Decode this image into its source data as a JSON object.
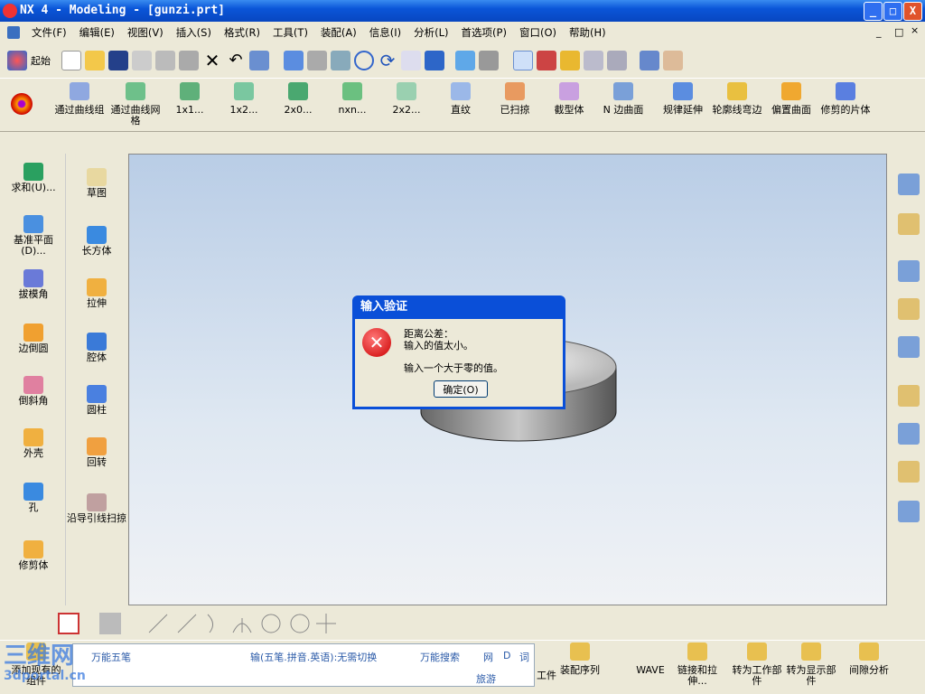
{
  "window": {
    "title": "NX 4 - Modeling - [gunzi.prt]",
    "minimize": "_",
    "maximize": "□",
    "close": "X",
    "doc_min": "_",
    "doc_max": "□",
    "doc_close": "×"
  },
  "menu": [
    "文件(F)",
    "编辑(E)",
    "视图(V)",
    "插入(S)",
    "格式(R)",
    "工具(T)",
    "装配(A)",
    "信息(I)",
    "分析(L)",
    "首选项(P)",
    "窗口(O)",
    "帮助(H)"
  ],
  "toolbar1": {
    "start_label": "起始",
    "icons": [
      "new-file-icon",
      "open-folder-icon",
      "save-icon",
      "cut-icon",
      "copy-icon",
      "paste-icon",
      "delete-icon",
      "undo-icon",
      "info-icon",
      "fit-icon",
      "zoom-window-icon",
      "zoom-area-icon",
      "zoom-icon",
      "rotate-icon",
      "pan-icon",
      "shade-icon",
      "cube-view-icon",
      "render-icon",
      "wcs-icon",
      "sketch-icon",
      "flow-icon",
      "measure-icon",
      "ruler-icon"
    ]
  },
  "toolbar2": {
    "tools": [
      "通过曲线组",
      "通过曲线网格",
      "1x1...",
      "1x2...",
      "2x0...",
      "nxn...",
      "2x2...",
      "直纹",
      "已扫掠",
      "截型体",
      "N 边曲面",
      "规律延伸",
      "轮廓线弯边",
      "偏置曲面",
      "修剪的片体"
    ]
  },
  "left_col1": [
    "求和(U)...",
    "基准平面(D)...",
    "拔模角",
    "边倒圆",
    "倒斜角",
    "外壳",
    "孔",
    "修剪体"
  ],
  "left_col2": [
    "草图",
    "长方体",
    "拉伸",
    "腔体",
    "圆柱",
    "回转",
    "沿导引线扫掠"
  ],
  "right_icons": [
    "assembly-navigator-icon",
    "part-navigator-icon",
    "web-browser-icon",
    "training-icon",
    "help-icon",
    "history-icon",
    "reuse-library-icon",
    "process-icon",
    "roles-icon"
  ],
  "bottom_toolbar2": {
    "tools": [
      "添加现有的组件",
      "装配序列",
      "WAVE",
      "链接和拉伸...",
      "转为工作部件",
      "转为显示部件",
      "间隙分析"
    ],
    "partial": "工件"
  },
  "ime": {
    "name": "万能五笔",
    "hint": "输(五笔.拼音.英语):无需切换",
    "search": "万能搜索",
    "links": [
      "网",
      "D",
      "词"
    ],
    "travel": "旅游"
  },
  "watermark": {
    "line1": "三维网",
    "line2": "3dportal.cn"
  },
  "dialog": {
    "title": "输入验证",
    "line1": "距离公差：",
    "line2": "输入的值太小。",
    "line3": "输入一个大于零的值。",
    "ok": "确定(O)",
    "icon": "error-icon"
  },
  "colors": {
    "title_bar": "#0a55d8",
    "viewport_top": "#b9cde6",
    "viewport_bottom": "#f0f2f5",
    "error": "#d42020"
  }
}
